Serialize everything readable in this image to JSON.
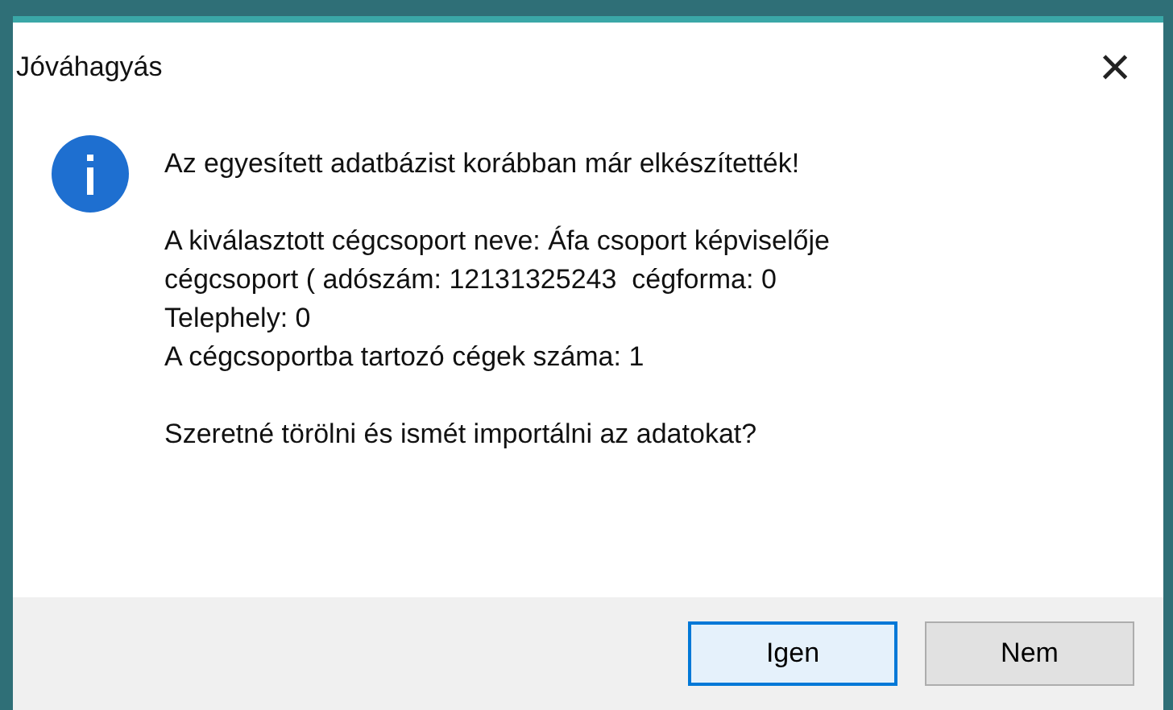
{
  "window": {
    "title": "Jóváhagyás",
    "close": "×"
  },
  "message": {
    "paragraphs": [
      [
        "Az egyesített adatbázist korábban már elkészítették!"
      ],
      [
        "A kiválasztott cégcsoport neve: Áfa csoport képviselője",
        "cégcsoport ( adószám: 12131325243  cégforma: 0",
        "Telephely: 0",
        "A cégcsoportba tartozó cégek száma: 1"
      ],
      [
        "Szeretné törölni és ismét importálni az adatokat?"
      ]
    ]
  },
  "buttons": [
    {
      "label": "Igen",
      "default": true
    },
    {
      "label": "Nem",
      "default": false
    }
  ]
}
